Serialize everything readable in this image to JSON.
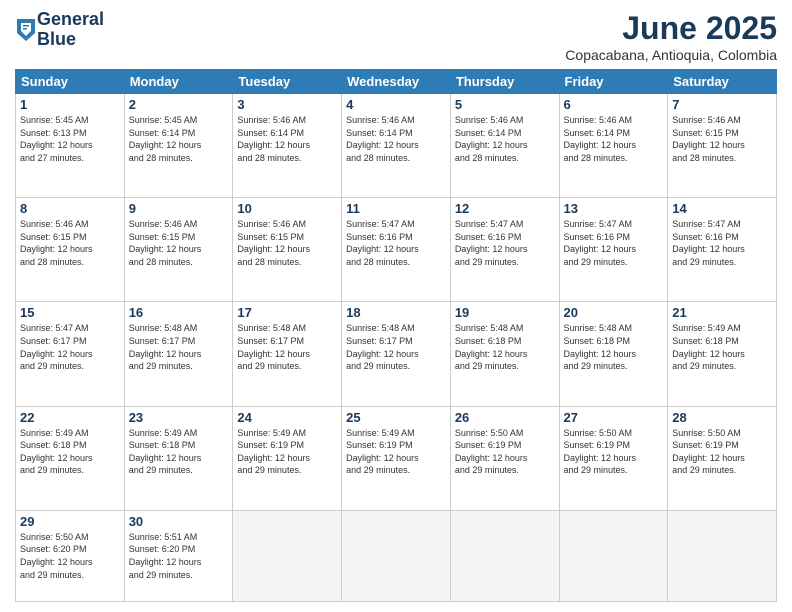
{
  "logo": {
    "line1": "General",
    "line2": "Blue"
  },
  "title": "June 2025",
  "subtitle": "Copacabana, Antioquia, Colombia",
  "days_of_week": [
    "Sunday",
    "Monday",
    "Tuesday",
    "Wednesday",
    "Thursday",
    "Friday",
    "Saturday"
  ],
  "weeks": [
    [
      {
        "day": "1",
        "info": "Sunrise: 5:45 AM\nSunset: 6:13 PM\nDaylight: 12 hours\nand 27 minutes."
      },
      {
        "day": "2",
        "info": "Sunrise: 5:45 AM\nSunset: 6:14 PM\nDaylight: 12 hours\nand 28 minutes."
      },
      {
        "day": "3",
        "info": "Sunrise: 5:46 AM\nSunset: 6:14 PM\nDaylight: 12 hours\nand 28 minutes."
      },
      {
        "day": "4",
        "info": "Sunrise: 5:46 AM\nSunset: 6:14 PM\nDaylight: 12 hours\nand 28 minutes."
      },
      {
        "day": "5",
        "info": "Sunrise: 5:46 AM\nSunset: 6:14 PM\nDaylight: 12 hours\nand 28 minutes."
      },
      {
        "day": "6",
        "info": "Sunrise: 5:46 AM\nSunset: 6:14 PM\nDaylight: 12 hours\nand 28 minutes."
      },
      {
        "day": "7",
        "info": "Sunrise: 5:46 AM\nSunset: 6:15 PM\nDaylight: 12 hours\nand 28 minutes."
      }
    ],
    [
      {
        "day": "8",
        "info": "Sunrise: 5:46 AM\nSunset: 6:15 PM\nDaylight: 12 hours\nand 28 minutes."
      },
      {
        "day": "9",
        "info": "Sunrise: 5:46 AM\nSunset: 6:15 PM\nDaylight: 12 hours\nand 28 minutes."
      },
      {
        "day": "10",
        "info": "Sunrise: 5:46 AM\nSunset: 6:15 PM\nDaylight: 12 hours\nand 28 minutes."
      },
      {
        "day": "11",
        "info": "Sunrise: 5:47 AM\nSunset: 6:16 PM\nDaylight: 12 hours\nand 28 minutes."
      },
      {
        "day": "12",
        "info": "Sunrise: 5:47 AM\nSunset: 6:16 PM\nDaylight: 12 hours\nand 29 minutes."
      },
      {
        "day": "13",
        "info": "Sunrise: 5:47 AM\nSunset: 6:16 PM\nDaylight: 12 hours\nand 29 minutes."
      },
      {
        "day": "14",
        "info": "Sunrise: 5:47 AM\nSunset: 6:16 PM\nDaylight: 12 hours\nand 29 minutes."
      }
    ],
    [
      {
        "day": "15",
        "info": "Sunrise: 5:47 AM\nSunset: 6:17 PM\nDaylight: 12 hours\nand 29 minutes."
      },
      {
        "day": "16",
        "info": "Sunrise: 5:48 AM\nSunset: 6:17 PM\nDaylight: 12 hours\nand 29 minutes."
      },
      {
        "day": "17",
        "info": "Sunrise: 5:48 AM\nSunset: 6:17 PM\nDaylight: 12 hours\nand 29 minutes."
      },
      {
        "day": "18",
        "info": "Sunrise: 5:48 AM\nSunset: 6:17 PM\nDaylight: 12 hours\nand 29 minutes."
      },
      {
        "day": "19",
        "info": "Sunrise: 5:48 AM\nSunset: 6:18 PM\nDaylight: 12 hours\nand 29 minutes."
      },
      {
        "day": "20",
        "info": "Sunrise: 5:48 AM\nSunset: 6:18 PM\nDaylight: 12 hours\nand 29 minutes."
      },
      {
        "day": "21",
        "info": "Sunrise: 5:49 AM\nSunset: 6:18 PM\nDaylight: 12 hours\nand 29 minutes."
      }
    ],
    [
      {
        "day": "22",
        "info": "Sunrise: 5:49 AM\nSunset: 6:18 PM\nDaylight: 12 hours\nand 29 minutes."
      },
      {
        "day": "23",
        "info": "Sunrise: 5:49 AM\nSunset: 6:18 PM\nDaylight: 12 hours\nand 29 minutes."
      },
      {
        "day": "24",
        "info": "Sunrise: 5:49 AM\nSunset: 6:19 PM\nDaylight: 12 hours\nand 29 minutes."
      },
      {
        "day": "25",
        "info": "Sunrise: 5:49 AM\nSunset: 6:19 PM\nDaylight: 12 hours\nand 29 minutes."
      },
      {
        "day": "26",
        "info": "Sunrise: 5:50 AM\nSunset: 6:19 PM\nDaylight: 12 hours\nand 29 minutes."
      },
      {
        "day": "27",
        "info": "Sunrise: 5:50 AM\nSunset: 6:19 PM\nDaylight: 12 hours\nand 29 minutes."
      },
      {
        "day": "28",
        "info": "Sunrise: 5:50 AM\nSunset: 6:19 PM\nDaylight: 12 hours\nand 29 minutes."
      }
    ],
    [
      {
        "day": "29",
        "info": "Sunrise: 5:50 AM\nSunset: 6:20 PM\nDaylight: 12 hours\nand 29 minutes."
      },
      {
        "day": "30",
        "info": "Sunrise: 5:51 AM\nSunset: 6:20 PM\nDaylight: 12 hours\nand 29 minutes."
      },
      {
        "day": "",
        "info": ""
      },
      {
        "day": "",
        "info": ""
      },
      {
        "day": "",
        "info": ""
      },
      {
        "day": "",
        "info": ""
      },
      {
        "day": "",
        "info": ""
      }
    ]
  ]
}
